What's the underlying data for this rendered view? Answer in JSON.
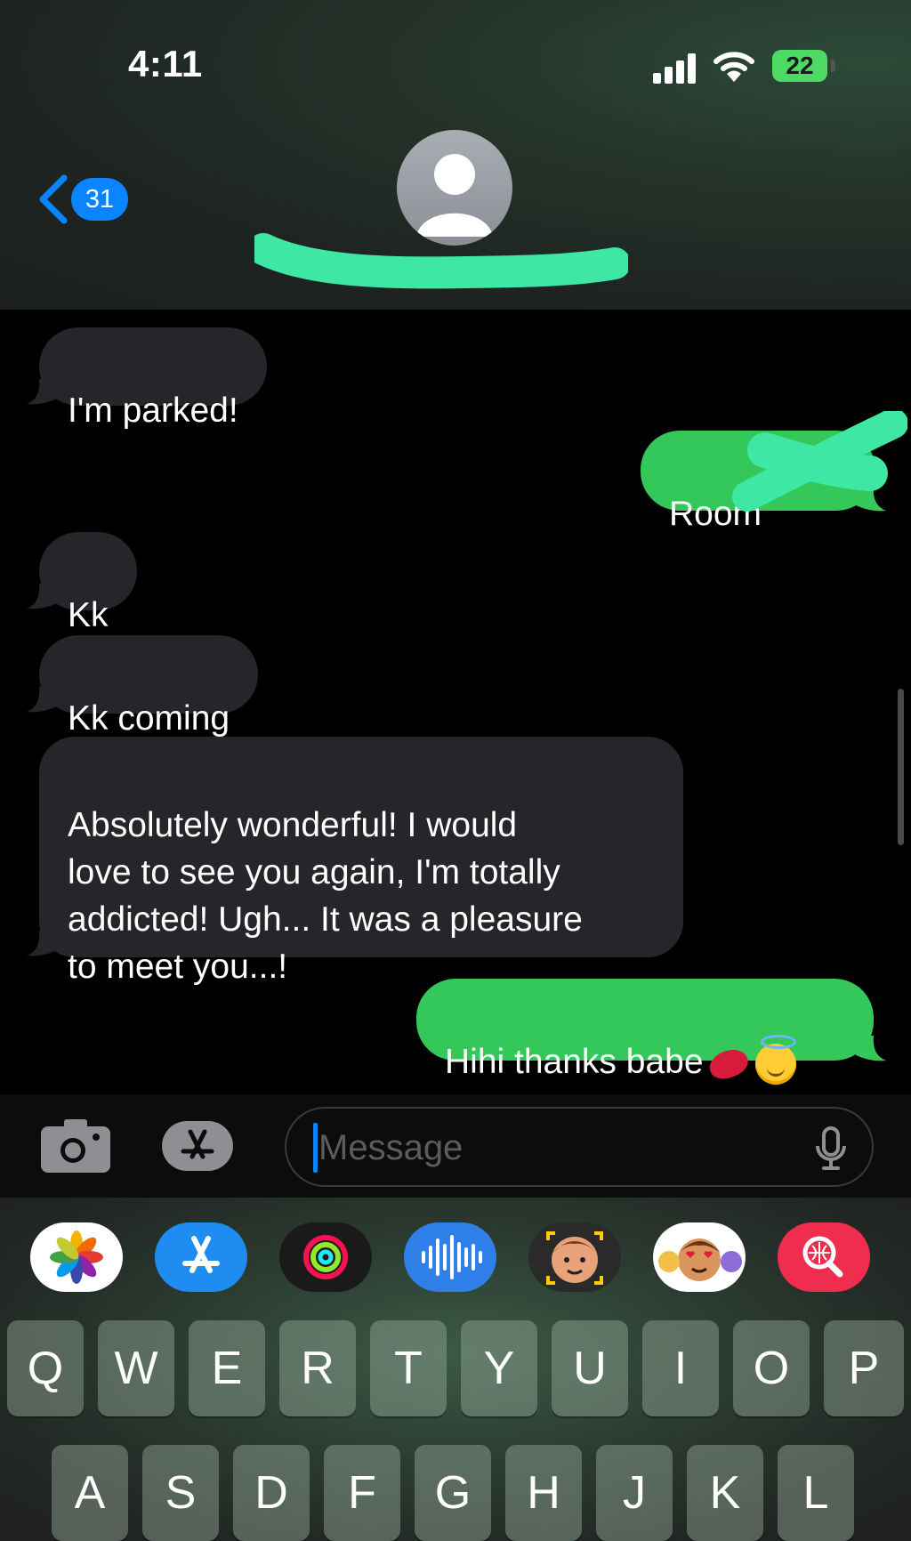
{
  "status_bar": {
    "time": "4:11",
    "battery": "22"
  },
  "nav": {
    "back_count": "31"
  },
  "conversation": {
    "messages": [
      {
        "direction": "received",
        "text": "I'm parked!"
      },
      {
        "direction": "sent",
        "text": "Room"
      },
      {
        "direction": "received",
        "text": "Kk"
      },
      {
        "direction": "received",
        "text": "Kk coming"
      },
      {
        "direction": "received",
        "text": "Absolutely wonderful! I would\nlove to see you again, I'm totally\naddicted! Ugh... It was a pleasure\nto meet you...!"
      },
      {
        "direction": "sent",
        "text": "Hihi thanks babe",
        "emojis": [
          "kiss-mark-icon",
          "smiling-face-with-halo-icon"
        ]
      }
    ]
  },
  "composer": {
    "placeholder": "Message"
  },
  "app_drawer": [
    "photos-icon",
    "app-store-icon",
    "activity-icon",
    "audio-message-icon",
    "memoji-stickers-icon",
    "animoji-icon",
    "images-search-icon"
  ],
  "keyboard": {
    "row1": [
      "Q",
      "W",
      "E",
      "R",
      "T",
      "Y",
      "U",
      "I",
      "O",
      "P"
    ],
    "row2": [
      "A",
      "S",
      "D",
      "F",
      "G",
      "H",
      "J",
      "K",
      "L"
    ]
  },
  "colors": {
    "sent_bubble": "#34c759",
    "received_bubble": "#26262a",
    "accent": "#0a84ff",
    "redaction": "#3ee8a4"
  }
}
